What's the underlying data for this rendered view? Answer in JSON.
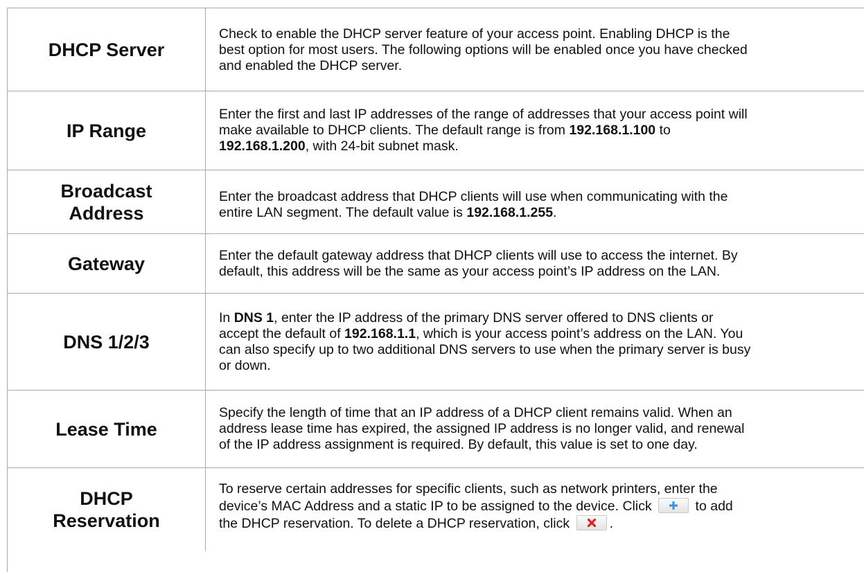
{
  "rows": [
    {
      "term": "DHCP Server",
      "lines": [
        [
          "Check to enable the DHCP server feature of your access point. Enabling DHCP is the"
        ],
        [
          "best option for most users. The following options will be enabled once you have checked"
        ],
        [
          "and enabled the DHCP server."
        ]
      ]
    },
    {
      "term": "IP Range",
      "lines": [
        [
          "Enter the first and last IP addresses of the range of addresses that your access point will"
        ],
        [
          "make available to DHCP clients. The default range is from ",
          "192.168.1.100",
          " to"
        ],
        [
          "192.168.1.200",
          ", with 24-bit subnet mask."
        ]
      ]
    },
    {
      "term_lines": [
        "Broadcast",
        "Address"
      ],
      "lines": [
        [
          "Enter the broadcast address that DHCP clients will use when communicating with the"
        ],
        [
          "entire LAN segment. The default value is ",
          "192.168.1.255",
          "."
        ]
      ]
    },
    {
      "term": "Gateway",
      "lines": [
        [
          "Enter the default gateway address that DHCP clients will use to access the internet. By"
        ],
        [
          "default, this address will be the same as your access point’s IP address on the LAN."
        ]
      ]
    },
    {
      "term": "DNS 1/2/3",
      "lines": [
        [
          "In ",
          "DNS 1",
          ", enter the IP address of the primary DNS server offered to DNS clients or"
        ],
        [
          "accept the default of ",
          "192.168.1.1",
          ", which is your access point’s address on the LAN. You"
        ],
        [
          "can also specify up to two additional DNS servers to use when the primary server is busy"
        ],
        [
          "or down."
        ]
      ]
    },
    {
      "term": "Lease Time",
      "lines": [
        [
          "Specify the length of time that an IP address of a DHCP client remains valid. When an"
        ],
        [
          "address lease time has expired, the assigned IP address is no longer valid, and renewal"
        ],
        [
          "of the IP address assignment is required. By default, this value is set to one day."
        ]
      ]
    },
    {
      "term_lines": [
        "DHCP",
        "Reservation"
      ],
      "lines": [
        [
          "To reserve certain addresses for specific clients, such as network printers, enter the"
        ],
        [
          "device’s MAC Address and a static IP to be assigned to the device. Click ",
          "[add-icon]",
          " to add"
        ],
        [
          "the DHCP reservation. To delete a DHCP reservation, click ",
          "[delete-icon]",
          "."
        ]
      ]
    }
  ],
  "icons": {
    "add": "plus-icon",
    "delete": "x-icon",
    "add_color": "#3a8fd6",
    "delete_color": "#e02020"
  }
}
